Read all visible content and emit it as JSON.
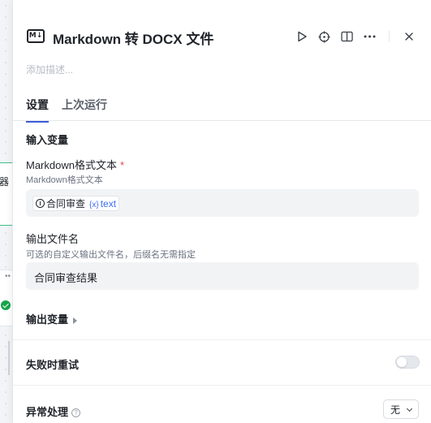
{
  "canvas": {
    "node_label_fragment": "器",
    "node_dots": "••"
  },
  "header": {
    "icon_text": "M↓",
    "title": "Markdown 转 DOCX 文件",
    "description_placeholder": "添加描述..."
  },
  "tabs": [
    {
      "label": "设置",
      "active": true
    },
    {
      "label": "上次运行",
      "active": false
    }
  ],
  "input_section": {
    "title": "输入变量",
    "markdown_field": {
      "label": "Markdown格式文本",
      "required_mark": "*",
      "sub_label": "Markdown格式文本",
      "chip_node": "合同审查",
      "chip_var_brace": "{x}",
      "chip_var": "text"
    },
    "filename_field": {
      "label": "输出文件名",
      "sub_label": "可选的自定义输出文件名，后缀名无需指定",
      "value": "合同审查结果"
    }
  },
  "output_section": {
    "title": "输出变量"
  },
  "retry": {
    "label": "失败时重试",
    "enabled": false
  },
  "error_handling": {
    "label": "异常处理",
    "help": "?",
    "selected": "无"
  }
}
